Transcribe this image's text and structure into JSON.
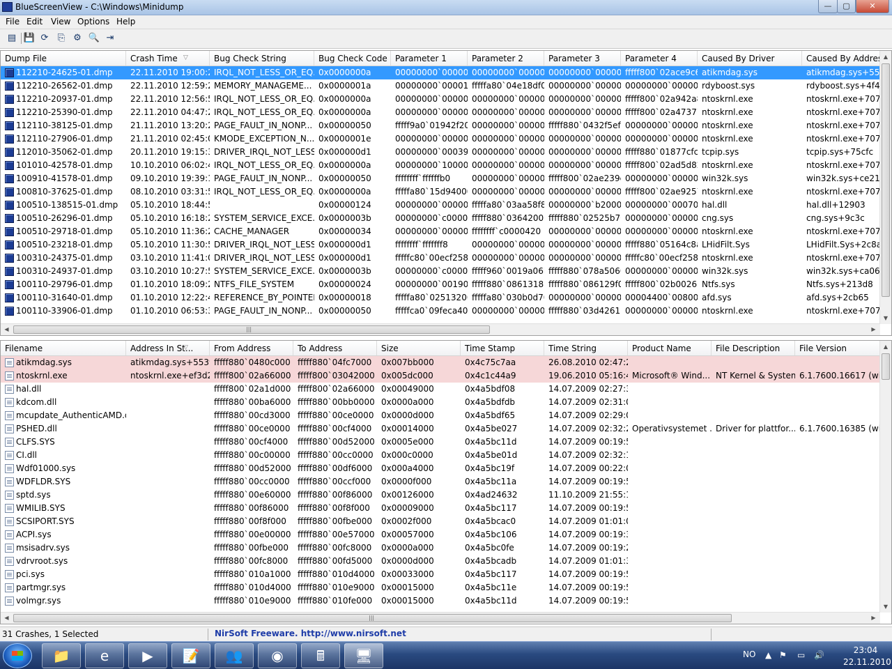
{
  "window": {
    "title": "BlueScreenView  -  C:\\Windows\\Minidump",
    "min_glyph": "—",
    "max_glyph": "▢",
    "close_glyph": "✕"
  },
  "menu": [
    "File",
    "Edit",
    "View",
    "Options",
    "Help"
  ],
  "toolbar": {
    "icons": [
      "properties-icon",
      "save-icon",
      "refresh-icon",
      "copy-icon",
      "advanced-options-icon",
      "find-icon",
      "exit-icon"
    ],
    "glyphs": [
      "▤",
      "💾",
      "⟳",
      "⎘",
      "⚙",
      "🔍",
      "⇥"
    ]
  },
  "crash_list": {
    "columns": [
      "Dump File",
      "Crash Time",
      "Bug Check String",
      "Bug Check Code",
      "Parameter 1",
      "Parameter 2",
      "Parameter 3",
      "Parameter 4",
      "Caused By Driver",
      "Caused By Address"
    ],
    "selected_index": 0,
    "rows": [
      [
        "112210-24625-01.dmp",
        "22.11.2010 19:00:24",
        "IRQL_NOT_LESS_OR_EQ...",
        "0x0000000a",
        "00000000`000000...",
        "00000000`000000...",
        "00000000`000000...",
        "fffff800`02ace9c6",
        "atikmdag.sys",
        "atikmdag.sys+5539a"
      ],
      [
        "112210-26562-01.dmp",
        "22.11.2010 12:59:25",
        "MEMORY_MANAGEME...",
        "0x0000001a",
        "00000000`000012...",
        "fffffa80`04e18df0",
        "00000000`000008...",
        "00000000`000000...",
        "rdyboost.sys",
        "rdyboost.sys+4f42"
      ],
      [
        "112210-20937-01.dmp",
        "22.11.2010 12:56:54",
        "IRQL_NOT_LESS_OR_EQ...",
        "0x0000000a",
        "00000000`000000...",
        "00000000`000000...",
        "00000000`000000...",
        "fffff800`02a942a8",
        "ntoskrnl.exe",
        "ntoskrnl.exe+70740"
      ],
      [
        "112210-25390-01.dmp",
        "22.11.2010 04:47:28",
        "IRQL_NOT_LESS_OR_EQ...",
        "0x0000000a",
        "00000000`000000...",
        "00000000`000000...",
        "00000000`000000...",
        "fffff800`02a47377",
        "ntoskrnl.exe",
        "ntoskrnl.exe+70740"
      ],
      [
        "112110-38125-01.dmp",
        "21.11.2010 13:20:23",
        "PAGE_FAULT_IN_NONP...",
        "0x00000050",
        "fffff9a0`01942f20",
        "00000000`000000...",
        "fffff880`0432f5ef",
        "00000000`000000...",
        "ntoskrnl.exe",
        "ntoskrnl.exe+70740"
      ],
      [
        "112110-27906-01.dmp",
        "21.11.2010 02:45:00",
        "KMODE_EXCEPTION_N...",
        "0x0000001e",
        "00000000`000000...",
        "00000000`000000...",
        "00000000`000000...",
        "00000000`000000...",
        "ntoskrnl.exe",
        "ntoskrnl.exe+70710"
      ],
      [
        "112010-35062-01.dmp",
        "20.11.2010 19:15:32",
        "DRIVER_IRQL_NOT_LESS...",
        "0x000000d1",
        "00000000`000391...",
        "00000000`000000...",
        "00000000`000000...",
        "fffff880`01877cfc",
        "tcpip.sys",
        "tcpip.sys+75cfc"
      ],
      [
        "101010-42578-01.dmp",
        "10.10.2010 06:02:41",
        "IRQL_NOT_LESS_OR_EQ...",
        "0x0000000a",
        "00000000`100000...",
        "00000000`000000...",
        "00000000`000000...",
        "fffff800`02ad5d82",
        "ntoskrnl.exe",
        "ntoskrnl.exe+70740"
      ],
      [
        "100910-41578-01.dmp",
        "09.10.2010 19:39:19",
        "PAGE_FAULT_IN_NONP...",
        "0x00000050",
        "ffffffff`ffffffb0",
        "00000000`000000...",
        "fffff800`02ae239c",
        "00000000`000000...",
        "win32k.sys",
        "win32k.sys+ce210"
      ],
      [
        "100810-37625-01.dmp",
        "08.10.2010 03:31:56",
        "IRQL_NOT_LESS_OR_EQ...",
        "0x0000000a",
        "fffffa80`15d94000",
        "00000000`000000...",
        "00000000`000000...",
        "fffff800`02ae9257",
        "ntoskrnl.exe",
        "ntoskrnl.exe+70740"
      ],
      [
        "100510-138515-01.dmp",
        "05.10.2010 18:44:54",
        "",
        "0x00000124",
        "00000000`000000...",
        "fffffa80`03aa58f8",
        "00000000`b20000...",
        "00000000`00070f0f",
        "hal.dll",
        "hal.dll+12903"
      ],
      [
        "100510-26296-01.dmp",
        "05.10.2010 16:18:26",
        "SYSTEM_SERVICE_EXCE...",
        "0x0000003b",
        "00000000`c00000...",
        "fffff880`03642000",
        "fffff880`02525b70",
        "00000000`000000...",
        "cng.sys",
        "cng.sys+9c3c"
      ],
      [
        "100510-29718-01.dmp",
        "05.10.2010 11:36:25",
        "CACHE_MANAGER",
        "0x00000034",
        "00000000`000001...",
        "ffffffff`c0000420",
        "00000000`000000...",
        "00000000`000000...",
        "ntoskrnl.exe",
        "ntoskrnl.exe+70740"
      ],
      [
        "100510-23218-01.dmp",
        "05.10.2010 11:30:55",
        "DRIVER_IRQL_NOT_LESS...",
        "0x000000d1",
        "ffffffff`fffffff8",
        "00000000`000000...",
        "00000000`000000...",
        "fffff880`05164c8a",
        "LHidFilt.Sys",
        "LHidFilt.Sys+2c8a"
      ],
      [
        "100310-24375-01.dmp",
        "03.10.2010 11:41:04",
        "DRIVER_IRQL_NOT_LESS...",
        "0x000000d1",
        "fffffc80`00ecf258",
        "00000000`000000...",
        "00000000`000000...",
        "fffffc80`00ecf258",
        "ntoskrnl.exe",
        "ntoskrnl.exe+70740"
      ],
      [
        "100310-24937-01.dmp",
        "03.10.2010 10:27:55",
        "SYSTEM_SERVICE_EXCE...",
        "0x0000003b",
        "00000000`c00000...",
        "fffff960`0019a06b",
        "fffff880`078a5060",
        "00000000`000000...",
        "win32k.sys",
        "win32k.sys+ca06b"
      ],
      [
        "100110-29796-01.dmp",
        "01.10.2010 18:09:21",
        "NTFS_FILE_SYSTEM",
        "0x00000024",
        "00000000`001904fb",
        "fffff880`08613188",
        "fffff880`086129f0",
        "fffff800`02b00260",
        "Ntfs.sys",
        "Ntfs.sys+213d8"
      ],
      [
        "100110-31640-01.dmp",
        "01.10.2010 12:22:49",
        "REFERENCE_BY_POINTER",
        "0x00000018",
        "fffffa80`02513200",
        "fffffa80`030b0d70",
        "00000000`000000...",
        "00004400`008000...",
        "afd.sys",
        "afd.sys+2cb65"
      ],
      [
        "100110-33906-01.dmp",
        "01.10.2010 06:53:30",
        "PAGE_FAULT_IN_NONP...",
        "0x00000050",
        "fffffca0`09feca40",
        "00000000`000000...",
        "fffff880`03d4261b",
        "00000000`000000...",
        "ntoskrnl.exe",
        "ntoskrnl.exe+70740"
      ]
    ]
  },
  "module_list": {
    "columns": [
      "Filename",
      "Address In St...",
      "From Address",
      "To Address",
      "Size",
      "Time Stamp",
      "Time String",
      "Product Name",
      "File Description",
      "File Version"
    ],
    "highlighted_count": 2,
    "rows": [
      [
        "atikmdag.sys",
        "atikmdag.sys+5539a",
        "fffff880`0480c000",
        "fffff880`04fc7000",
        "0x007bb000",
        "0x4c75c7aa",
        "26.08.2010 02:47:22",
        "",
        "",
        ""
      ],
      [
        "ntoskrnl.exe",
        "ntoskrnl.exe+ef3d2",
        "fffff800`02a66000",
        "fffff800`03042000",
        "0x005dc000",
        "0x4c1c44a9",
        "19.06.2010 05:16:41",
        "Microsoft® Wind...",
        "NT Kernel & System",
        "6.1.7600.16617 (wi..."
      ],
      [
        "hal.dll",
        "",
        "fffff800`02a1d000",
        "fffff800`02a66000",
        "0x00049000",
        "0x4a5bdf08",
        "14.07.2009 02:27:36",
        "",
        "",
        ""
      ],
      [
        "kdcom.dll",
        "",
        "fffff880`00ba6000",
        "fffff880`00bb0000",
        "0x0000a000",
        "0x4a5bdfdb",
        "14.07.2009 02:31:07",
        "",
        "",
        ""
      ],
      [
        "mcupdate_AuthenticAMD.dll",
        "",
        "fffff880`00cd3000",
        "fffff880`00ce0000",
        "0x0000d000",
        "0x4a5bdf65",
        "14.07.2009 02:29:09",
        "",
        "",
        ""
      ],
      [
        "PSHED.dll",
        "",
        "fffff880`00ce0000",
        "fffff880`00cf4000",
        "0x00014000",
        "0x4a5be027",
        "14.07.2009 02:32:23",
        "Operativsystemet ...",
        "Driver for plattfor...",
        "6.1.7600.16385 (wi..."
      ],
      [
        "CLFS.SYS",
        "",
        "fffff880`00cf4000",
        "fffff880`00d52000",
        "0x0005e000",
        "0x4a5bc11d",
        "14.07.2009 00:19:57",
        "",
        "",
        ""
      ],
      [
        "CI.dll",
        "",
        "fffff880`00c00000",
        "fffff880`00cc0000",
        "0x000c0000",
        "0x4a5be01d",
        "14.07.2009 02:32:13",
        "",
        "",
        ""
      ],
      [
        "Wdf01000.sys",
        "",
        "fffff880`00d52000",
        "fffff880`00df6000",
        "0x000a4000",
        "0x4a5bc19f",
        "14.07.2009 00:22:07",
        "",
        "",
        ""
      ],
      [
        "WDFLDR.SYS",
        "",
        "fffff880`00cc0000",
        "fffff880`00ccf000",
        "0x0000f000",
        "0x4a5bc11a",
        "14.07.2009 00:19:54",
        "",
        "",
        ""
      ],
      [
        "sptd.sys",
        "",
        "fffff880`00e60000",
        "fffff880`00f86000",
        "0x00126000",
        "0x4ad24632",
        "11.10.2009 21:55:14",
        "",
        "",
        ""
      ],
      [
        "WMILIB.SYS",
        "",
        "fffff880`00f86000",
        "fffff880`00f8f000",
        "0x00009000",
        "0x4a5bc117",
        "14.07.2009 00:19:51",
        "",
        "",
        ""
      ],
      [
        "SCSIPORT.SYS",
        "",
        "fffff880`00f8f000",
        "fffff880`00fbe000",
        "0x0002f000",
        "0x4a5bcac0",
        "14.07.2009 01:01:04",
        "",
        "",
        ""
      ],
      [
        "ACPI.sys",
        "",
        "fffff880`00e00000",
        "fffff880`00e57000",
        "0x00057000",
        "0x4a5bc106",
        "14.07.2009 00:19:34",
        "",
        "",
        ""
      ],
      [
        "msisadrv.sys",
        "",
        "fffff880`00fbe000",
        "fffff880`00fc8000",
        "0x0000a000",
        "0x4a5bc0fe",
        "14.07.2009 00:19:26",
        "",
        "",
        ""
      ],
      [
        "vdrvroot.sys",
        "",
        "fffff880`00fc8000",
        "fffff880`00fd5000",
        "0x0000d000",
        "0x4a5bcadb",
        "14.07.2009 01:01:31",
        "",
        "",
        ""
      ],
      [
        "pci.sys",
        "",
        "fffff880`010a1000",
        "fffff880`010d4000",
        "0x00033000",
        "0x4a5bc117",
        "14.07.2009 00:19:51",
        "",
        "",
        ""
      ],
      [
        "partmgr.sys",
        "",
        "fffff880`010d4000",
        "fffff880`010e9000",
        "0x00015000",
        "0x4a5bc11e",
        "14.07.2009 00:19:58",
        "",
        "",
        ""
      ],
      [
        "volmgr.sys",
        "",
        "fffff880`010e9000",
        "fffff880`010fe000",
        "0x00015000",
        "0x4a5bc11d",
        "14.07.2009 00:19:57",
        "",
        "",
        ""
      ]
    ]
  },
  "status": {
    "count": "31 Crashes, 1 Selected",
    "credit": "NirSoft Freeware.  http://www.nirsoft.net"
  },
  "taskbar": {
    "items": [
      "explorer-icon",
      "internet-explorer-icon",
      "media-player-icon",
      "sticky-notes-icon",
      "users-icon",
      "chrome-icon",
      "calculator-icon",
      "bluescreenview-icon"
    ],
    "glyphs": [
      "📁",
      "e",
      "▶",
      "📝",
      "👥",
      "◉",
      "🖩",
      "🖥"
    ],
    "active_index": 7
  },
  "tray": {
    "language": "NO",
    "time": "23:04",
    "date": "22.11.2010",
    "icons": [
      "show-hidden-icons-icon",
      "action-center-flag-icon",
      "network-icon",
      "volume-icon"
    ],
    "glyphs": [
      "▲",
      "⚑",
      "▭",
      "🔊"
    ]
  }
}
